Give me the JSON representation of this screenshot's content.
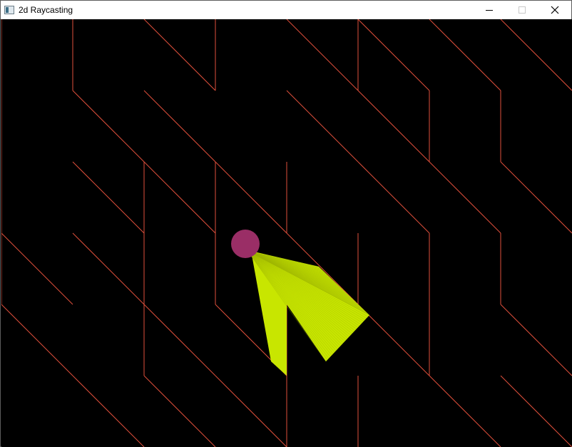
{
  "window": {
    "title": "2d Raycasting",
    "controls": [
      "minimize-icon",
      "maximize-icon",
      "close-icon"
    ]
  },
  "colors": {
    "wall": "#e0503c",
    "rays": "#c8e600",
    "player": "#9a2e66",
    "background": "#000000"
  }
}
